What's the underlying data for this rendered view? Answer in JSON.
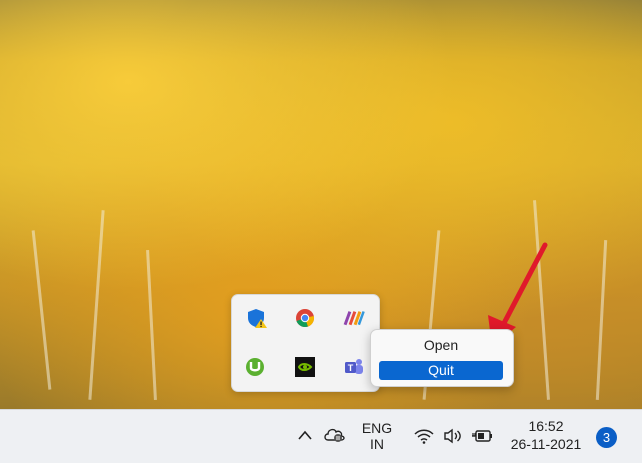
{
  "tray_overflow": {
    "icons": [
      "defender-warning-icon",
      "chrome-icon",
      "winrar-icon",
      "utorrent-icon",
      "nvidia-icon",
      "teams-icon"
    ]
  },
  "context_menu": {
    "items": [
      {
        "label": "Open",
        "selected": false
      },
      {
        "label": "Quit",
        "selected": true
      }
    ]
  },
  "taskbar": {
    "language_line1": "ENG",
    "language_line2": "IN",
    "time": "16:52",
    "date": "26-11-2021",
    "notification_count": "3",
    "accent_color": "#0a5ec6"
  }
}
